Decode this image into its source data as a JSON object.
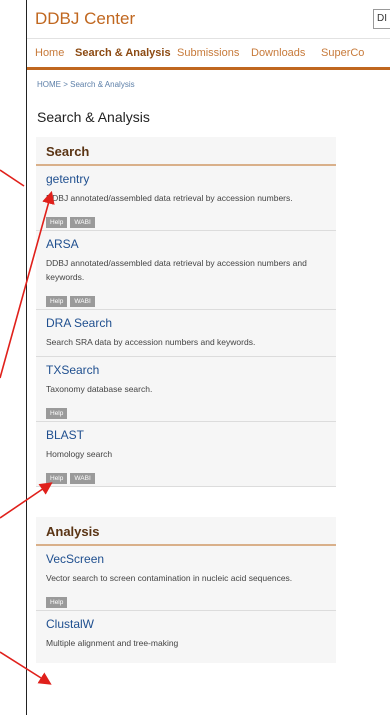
{
  "header": {
    "title": "DDBJ Center",
    "lang_label": "DI"
  },
  "nav": {
    "items": [
      {
        "label": "Home"
      },
      {
        "label": "Search & Analysis"
      },
      {
        "label": "Submissions"
      },
      {
        "label": "Downloads"
      },
      {
        "label": "SuperCo"
      }
    ]
  },
  "breadcrumb": "HOME > Search & Analysis",
  "page_title": "Search & Analysis",
  "search": {
    "heading": "Search",
    "items": [
      {
        "name": "getentry",
        "desc": "DDBJ annotated/assembled data retrieval by accession numbers.",
        "help": "Help",
        "wabi": "WABI"
      },
      {
        "name": "ARSA",
        "desc": "DDBJ annotated/assembled data retrieval by accession numbers and keywords.",
        "help": "Help",
        "wabi": "WABI"
      },
      {
        "name": "DRA Search",
        "desc": "Search SRA data by accession numbers and keywords."
      },
      {
        "name": "TXSearch",
        "desc": "Taxonomy database search.",
        "help": "Help"
      },
      {
        "name": "BLAST",
        "desc": "Homology search",
        "help": "Help",
        "wabi": "WABI"
      }
    ]
  },
  "analysis": {
    "heading": "Analysis",
    "items": [
      {
        "name": "VecScreen",
        "desc": "Vector search to screen contamination in nucleic acid sequences.",
        "help": "Help"
      },
      {
        "name": "ClustalW",
        "desc": "Multiple alignment and tree-making"
      }
    ]
  },
  "colors": {
    "accent": "#c0671f",
    "link": "#1f4f8f",
    "arrow": "#e0201b"
  }
}
